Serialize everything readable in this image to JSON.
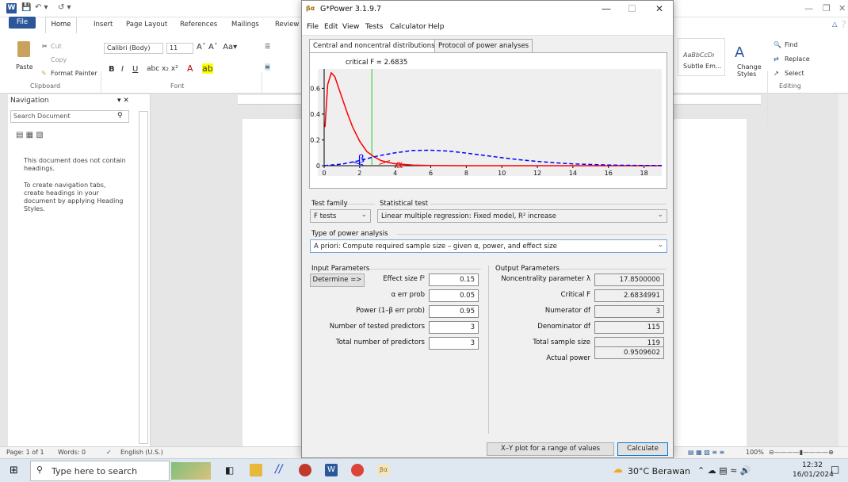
{
  "word": {
    "tabs": [
      "File",
      "Home",
      "Insert",
      "Page Layout",
      "References",
      "Mailings",
      "Review"
    ],
    "clipboard": {
      "paste": "Paste",
      "cut": "Cut",
      "copy": "Copy",
      "format_painter": "Format Painter",
      "group": "Clipboard"
    },
    "font": {
      "name": "Calibri (Body)",
      "size": "11",
      "group": "Font"
    },
    "styles": {
      "sample": "AaBbCcDı",
      "subtle": "Subtle Em...",
      "change_styles": "Change Styles"
    },
    "editing": {
      "find": "Find",
      "replace": "Replace",
      "select": "Select",
      "group": "Editing"
    },
    "navigation": {
      "title": "Navigation",
      "search_placeholder": "Search Document",
      "msg1": "This document does not contain headings.",
      "msg2": "To create navigation tabs, create headings in your document by applying Heading Styles."
    },
    "status": {
      "page": "Page: 1 of 1",
      "words": "Words: 0",
      "language": "English (U.S.)",
      "zoom": "100%"
    }
  },
  "gpower": {
    "title": "G*Power 3.1.9.7",
    "menu": [
      "File",
      "Edit",
      "View",
      "Tests",
      "Calculator",
      "Help"
    ],
    "tabs": [
      "Central and noncentral distributions",
      "Protocol of power analyses"
    ],
    "test_family_label": "Test family",
    "test_family": "F tests",
    "statistical_test_label": "Statistical test",
    "statistical_test": "Linear multiple regression: Fixed model, R² increase",
    "power_analysis_label": "Type of power analysis",
    "power_analysis": "A priori: Compute required sample size – given α, power, and effect size",
    "input_title": "Input Parameters",
    "determine": "Determine =>",
    "inputs": [
      {
        "label": "Effect size f²",
        "value": "0.15"
      },
      {
        "label": "α err prob",
        "value": "0.05"
      },
      {
        "label": "Power (1–β err prob)",
        "value": "0.95"
      },
      {
        "label": "Number of tested predictors",
        "value": "3"
      },
      {
        "label": "Total number of predictors",
        "value": "3"
      }
    ],
    "output_title": "Output Parameters",
    "outputs": [
      {
        "label": "Noncentrality parameter λ",
        "value": "17.8500000"
      },
      {
        "label": "Critical F",
        "value": "2.6834991"
      },
      {
        "label": "Numerator df",
        "value": "3"
      },
      {
        "label": "Denominator df",
        "value": "115"
      },
      {
        "label": "Total sample size",
        "value": "119"
      },
      {
        "label": "Actual power",
        "value": "0.9509602"
      }
    ],
    "xy_button": "X–Y plot for a range of values",
    "calculate_button": "Calculate"
  },
  "chart_data": {
    "type": "line",
    "critical_label": "critical F = 2.6835",
    "critical_x": 2.6835,
    "xlim": [
      0,
      19
    ],
    "ylim": [
      0,
      0.75
    ],
    "x_ticks": [
      "0",
      "2",
      "4",
      "6",
      "8",
      "10",
      "12",
      "14",
      "16",
      "18"
    ],
    "y_ticks": [
      "0",
      "0.2",
      "0.4",
      "0.6"
    ],
    "annotations": [
      "β",
      "α"
    ],
    "series": [
      {
        "curve": "central F(3,115)",
        "color": "#ff0000",
        "style": "solid",
        "x": [
          0.05,
          0.2,
          0.4,
          0.6,
          0.8,
          1.0,
          1.3,
          1.6,
          2.0,
          2.4,
          2.8,
          3.2,
          3.6,
          4.0,
          5.0,
          6.0,
          8.0,
          10.0,
          19.0
        ],
        "y": [
          0.3,
          0.63,
          0.72,
          0.69,
          0.61,
          0.53,
          0.41,
          0.3,
          0.19,
          0.11,
          0.07,
          0.04,
          0.025,
          0.015,
          0.005,
          0.002,
          0.0,
          0.0,
          0.0
        ]
      },
      {
        "curve": "noncentral F(3,115,λ=17.85)",
        "color": "#0000ff",
        "style": "dashed",
        "x": [
          0.0,
          1.0,
          2.0,
          3.0,
          4.0,
          5.0,
          6.0,
          7.0,
          8.0,
          9.0,
          10.0,
          11.0,
          12.0,
          13.0,
          14.0,
          15.0,
          16.0,
          17.0,
          18.0,
          19.0
        ],
        "y": [
          0.0,
          0.012,
          0.04,
          0.075,
          0.1,
          0.118,
          0.12,
          0.113,
          0.098,
          0.08,
          0.062,
          0.046,
          0.033,
          0.022,
          0.014,
          0.009,
          0.005,
          0.003,
          0.002,
          0.001
        ]
      }
    ]
  },
  "taskbar": {
    "search_placeholder": "Type here to search",
    "weather": "30°C Berawan",
    "time": "12:32",
    "date": "16/01/2024"
  }
}
